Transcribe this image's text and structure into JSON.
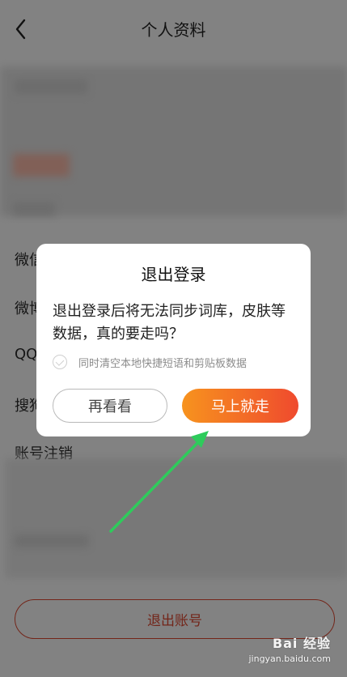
{
  "header": {
    "title": "个人资料",
    "back_icon": "chevron-left-icon"
  },
  "background_rows": [
    {
      "label": "微信"
    },
    {
      "label": "微博"
    },
    {
      "label": "QQ"
    },
    {
      "label": "搜狗"
    },
    {
      "label": "账号注销"
    }
  ],
  "logout_button": {
    "label": "退出账号",
    "color": "#d4452f"
  },
  "dialog": {
    "title": "退出登录",
    "message": "退出登录后将无法同步词库，皮肤等数据，真的要走吗？",
    "checkbox_label": "同时清空本地快捷短语和剪贴板数据",
    "cancel_label": "再看看",
    "confirm_label": "马上就走",
    "confirm_gradient": [
      "#f7931e",
      "#ef4a2e"
    ]
  },
  "annotation": {
    "arrow_color": "#2ecb5b"
  },
  "watermark": {
    "main": "Bai 经验",
    "sub": "jingyan.baidu.com"
  }
}
